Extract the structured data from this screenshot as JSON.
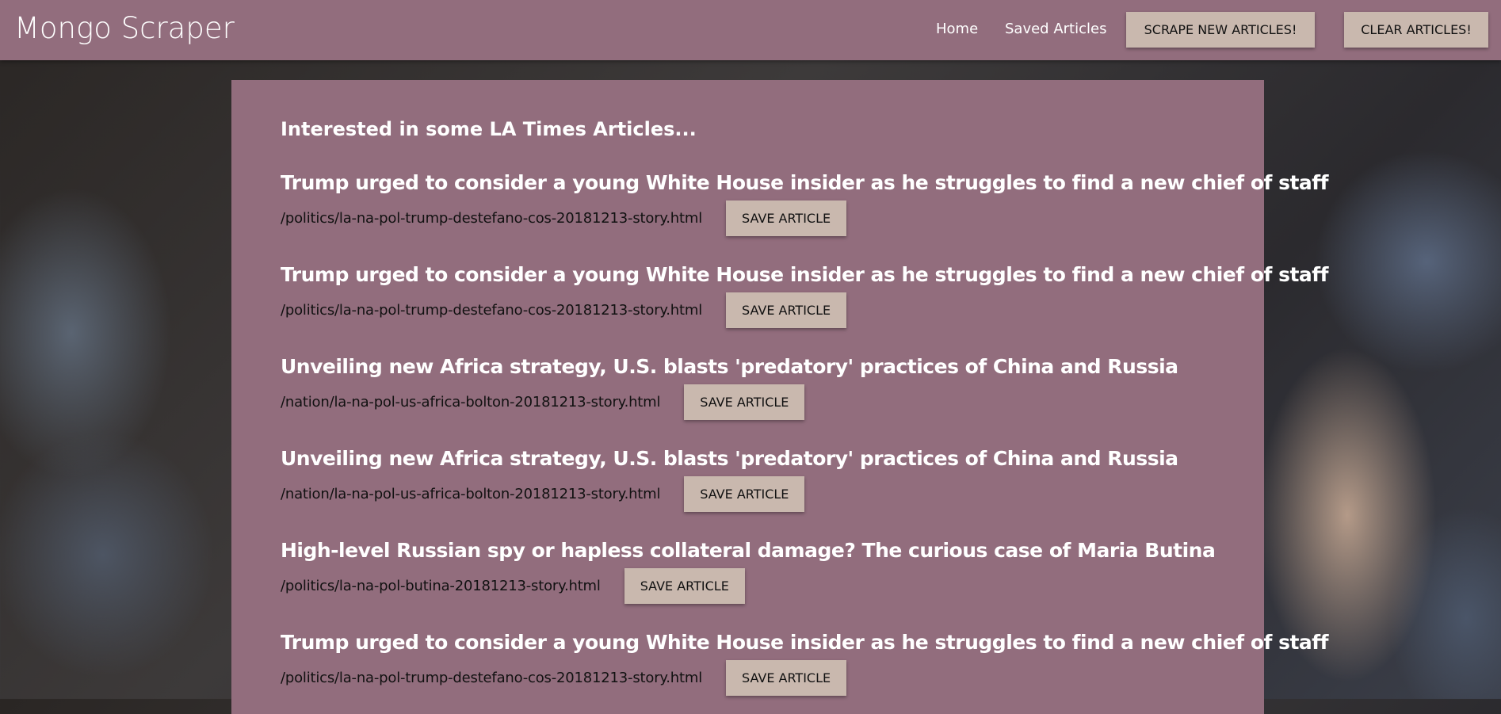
{
  "nav": {
    "brand": "Mongo Scraper",
    "home": "Home",
    "saved": "Saved Articles",
    "scrape": "SCRAPE NEW ARTICLES!",
    "clear": "CLEAR ARTICLES!"
  },
  "main": {
    "intro": "Interested in some LA Times Articles...",
    "save_label": "SAVE ARTICLE",
    "articles": [
      {
        "title": "Trump urged to consider a young White House insider as he struggles to find a new chief of staff",
        "url": "/politics/la-na-pol-trump-destefano-cos-20181213-story.html"
      },
      {
        "title": "Trump urged to consider a young White House insider as he struggles to find a new chief of staff",
        "url": "/politics/la-na-pol-trump-destefano-cos-20181213-story.html"
      },
      {
        "title": "Unveiling new Africa strategy, U.S. blasts 'predatory' practices of China and Russia",
        "url": "/nation/la-na-pol-us-africa-bolton-20181213-story.html"
      },
      {
        "title": "Unveiling new Africa strategy, U.S. blasts 'predatory' practices of China and Russia",
        "url": "/nation/la-na-pol-us-africa-bolton-20181213-story.html"
      },
      {
        "title": "High-level Russian spy or hapless collateral damage? The curious case of Maria Butina",
        "url": "/politics/la-na-pol-butina-20181213-story.html"
      },
      {
        "title": "Trump urged to consider a young White House insider as he struggles to find a new chief of staff",
        "url": "/politics/la-na-pol-trump-destefano-cos-20181213-story.html"
      }
    ]
  }
}
